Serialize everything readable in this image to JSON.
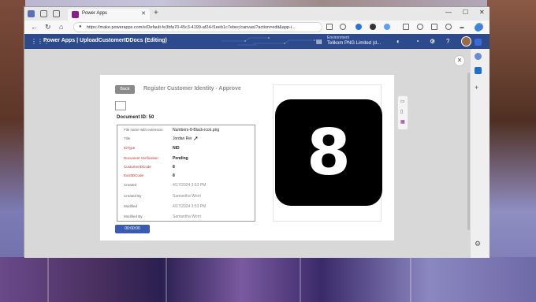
{
  "browser": {
    "tab_title": "Power Apps",
    "tab_close": "✕",
    "new_tab": "+",
    "url": "https://make.powerapps.com/e/Default-fe3bfa70-45c3-4199-af24-f1eeb1c7ebec/canvas/?action=edit&app-i...",
    "minimize": "—",
    "maximize": "☐",
    "close": "✕",
    "back": "←",
    "refresh": "↻",
    "home": "⌂",
    "lock": "🔒"
  },
  "app_header": {
    "title": "Power Apps  |  UploadCustomerIDDocs (Editing)",
    "environment_label": "Environment",
    "environment_name": "Telikom PNG Limited (d...",
    "waffle": "⋮⋮⋮"
  },
  "form": {
    "back_label": "Back",
    "title": "Register Customer Identity - Approve",
    "document_id": "Document ID: 50",
    "fields": [
      {
        "label": "File name with extension",
        "value": "Numbers-8-Black-icon.png",
        "style": "normal",
        "label_color": "gray"
      },
      {
        "label": "Title",
        "value": "Jordan Rei",
        "style": "normal",
        "label_color": "gray"
      },
      {
        "label": "IDType",
        "value": "NID",
        "style": "bold",
        "label_color": "red"
      },
      {
        "label": "Document Verification",
        "value": "Pending",
        "style": "bold",
        "label_color": "red"
      },
      {
        "label": "CustomerIDCode",
        "value": "8",
        "style": "bold",
        "label_color": "red"
      },
      {
        "label": "ExistIDCode",
        "value": "8",
        "style": "bold",
        "label_color": "red"
      },
      {
        "label": "Created",
        "value": "4/17/2024 3:53 PM",
        "style": "muted",
        "label_color": "gray"
      },
      {
        "label": "Created By",
        "value": "Samantha Worri",
        "style": "muted",
        "label_color": "gray"
      },
      {
        "label": "Modified",
        "value": "4/17/2024 3:53 PM",
        "style": "muted",
        "label_color": "gray"
      },
      {
        "label": "Modified By",
        "value": "Samantha Worri",
        "style": "muted",
        "label_color": "gray"
      }
    ],
    "submit_label": "00:00:00",
    "preview_digit": "8"
  },
  "close_dialog": "✕",
  "colors": {
    "header_bg": "#2c4a8c",
    "button_blue": "#3a5bb0",
    "required_red": "#c03030"
  }
}
